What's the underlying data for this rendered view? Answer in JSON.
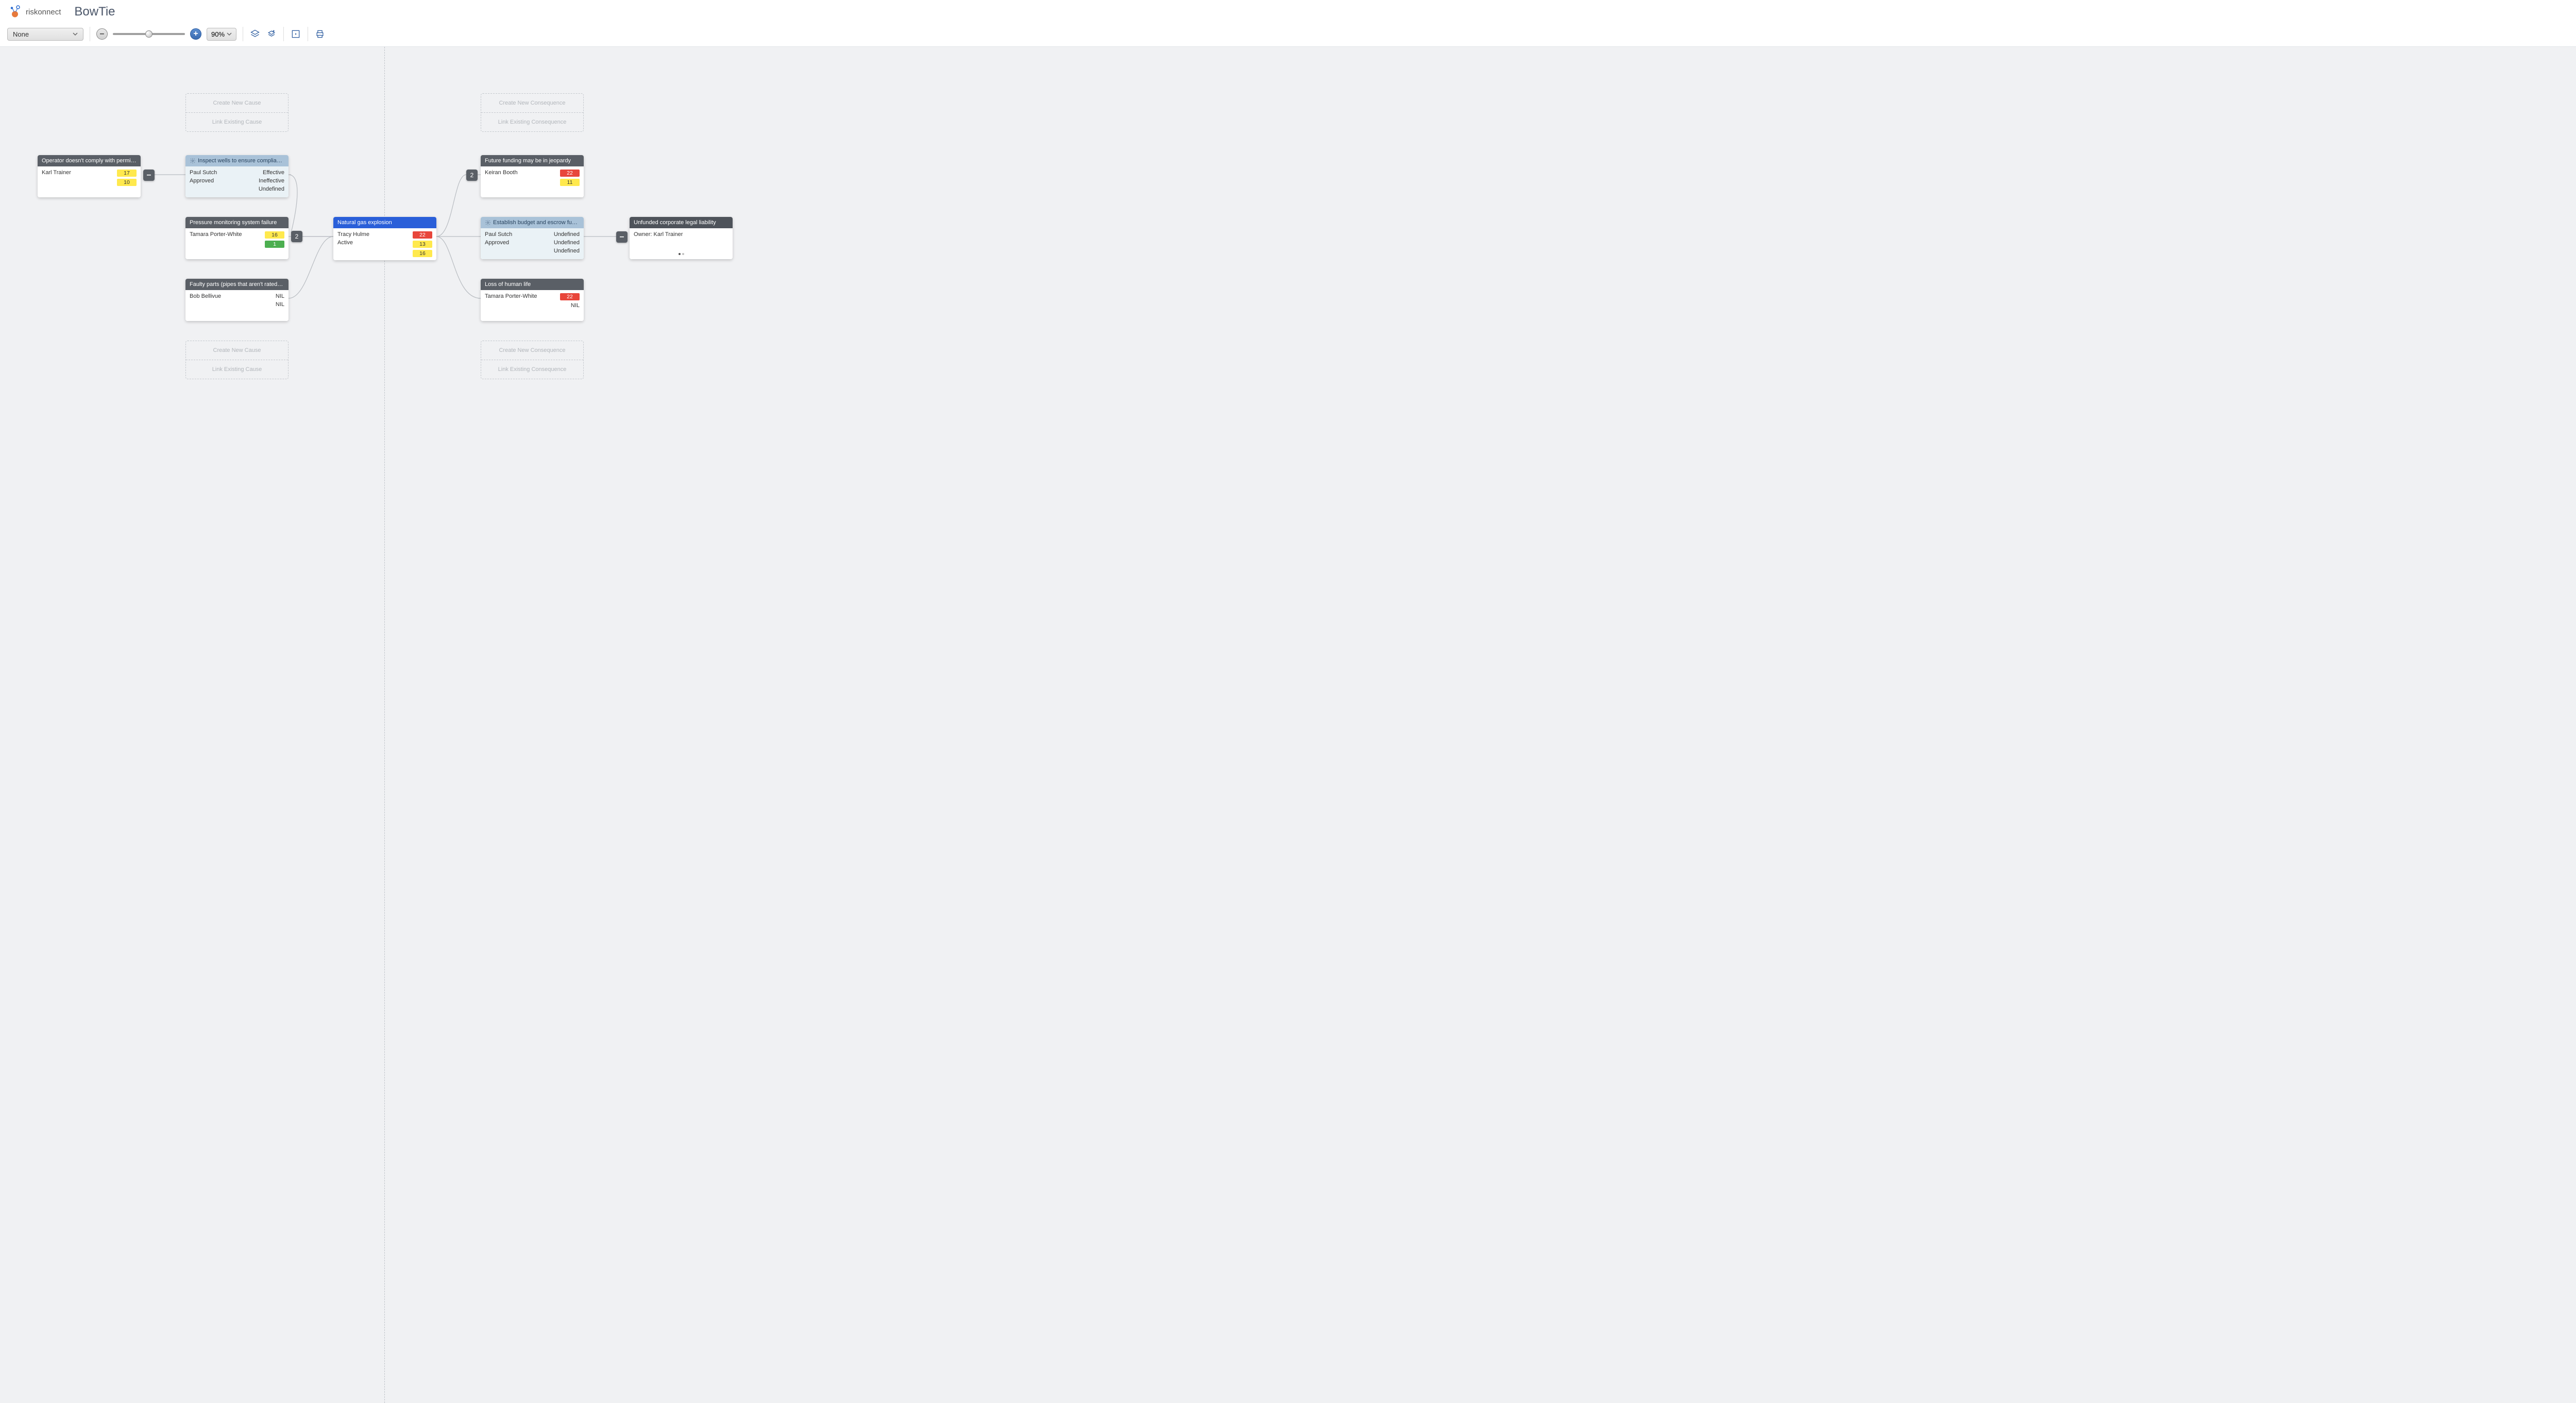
{
  "brand": {
    "name": "riskonnect"
  },
  "app": {
    "title": "BowTie"
  },
  "toolbar": {
    "filter_label": "None",
    "zoom_level": "90%",
    "slider_percent": 45
  },
  "ghosts": {
    "create_cause": "Create New Cause",
    "link_cause": "Link Existing Cause",
    "create_consequence": "Create New Consequence",
    "link_consequence": "Link Existing Consequence"
  },
  "nodes": {
    "cause1": {
      "title": "Operator doesn't comply with permit cond...",
      "owner": "Karl Trainer",
      "badges": [
        "17",
        "10"
      ]
    },
    "control1": {
      "title": "Inspect wells to ensure compliance wit...",
      "owner": "Paul Sutch",
      "approval": "Approved",
      "metrics": [
        "Effective",
        "Ineffective",
        "Undefined"
      ]
    },
    "cause2": {
      "title": "Pressure monitoring system failure",
      "owner": "Tamara Porter-White",
      "badges": [
        "16",
        "1"
      ],
      "badge_colors": [
        "yellow",
        "green"
      ]
    },
    "cause3": {
      "title": "Faulty parts (pipes that aren't rated prope...",
      "owner": "Bob Bellivue",
      "metrics": [
        "NIL",
        "NIL"
      ]
    },
    "event": {
      "title": "Natural gas explosion",
      "owner": "Tracy Hulme",
      "status": "Active",
      "badges": [
        "22",
        "13",
        "16"
      ],
      "badge_colors": [
        "red",
        "yellow",
        "yellow"
      ]
    },
    "consequence1": {
      "title": "Future funding may be in jeopardy",
      "owner": "Keiran Booth",
      "badges": [
        "22",
        "11"
      ],
      "badge_colors": [
        "red",
        "yellow"
      ]
    },
    "control2": {
      "title": "Establish budget and escrow fund for ...",
      "owner": "Paul Sutch",
      "approval": "Approved",
      "metrics": [
        "Undefined",
        "Undefined",
        "Undefined"
      ]
    },
    "consequence3": {
      "title": "Loss of human life",
      "owner": "Tamara Porter-White",
      "badges": [
        "22",
        "NIL"
      ],
      "badge_colors": [
        "red",
        "nil"
      ]
    },
    "consequence_far": {
      "title": "Unfunded corporate legal liability",
      "owner_label": "Owner: Karl Trainer"
    }
  },
  "counts": {
    "left": "2",
    "right": "2"
  },
  "collapse": {
    "left": "–",
    "right": "–"
  }
}
